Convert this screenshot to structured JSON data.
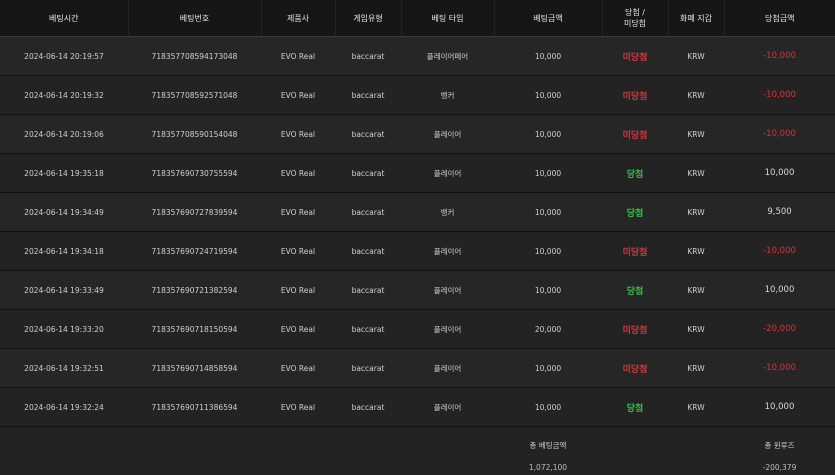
{
  "headers": {
    "bet_time": "베팅시간",
    "bet_id": "베팅번호",
    "provider": "제품사",
    "game_type": "게임유형",
    "bet_type": "베팅 타입",
    "bet_amount": "베팅금액",
    "result": "당첨 / 미당첨",
    "currency": "화폐 지갑",
    "payout": "당첨금액"
  },
  "rows": [
    {
      "time": "2024-06-14 20:19:57",
      "id": "718357708594173048",
      "provider": "EVO Real",
      "game": "baccarat",
      "type": "플레이어페어",
      "amount": "10,000",
      "result": "미당첨",
      "result_status": "lose",
      "currency": "KRW",
      "payout": "-10,000"
    },
    {
      "time": "2024-06-14 20:19:32",
      "id": "718357708592571048",
      "provider": "EVO Real",
      "game": "baccarat",
      "type": "뱅커",
      "amount": "10,000",
      "result": "미당첨",
      "result_status": "lose",
      "currency": "KRW",
      "payout": "-10,000"
    },
    {
      "time": "2024-06-14 20:19:06",
      "id": "718357708590154048",
      "provider": "EVO Real",
      "game": "baccarat",
      "type": "플레이어",
      "amount": "10,000",
      "result": "미당첨",
      "result_status": "lose",
      "currency": "KRW",
      "payout": "-10,000"
    },
    {
      "time": "2024-06-14 19:35:18",
      "id": "718357690730755594",
      "provider": "EVO Real",
      "game": "baccarat",
      "type": "플레이어",
      "amount": "10,000",
      "result": "당첨",
      "result_status": "win",
      "currency": "KRW",
      "payout": "10,000"
    },
    {
      "time": "2024-06-14 19:34:49",
      "id": "718357690727839594",
      "provider": "EVO Real",
      "game": "baccarat",
      "type": "뱅커",
      "amount": "10,000",
      "result": "당첨",
      "result_status": "win",
      "currency": "KRW",
      "payout": "9,500"
    },
    {
      "time": "2024-06-14 19:34:18",
      "id": "718357690724719594",
      "provider": "EVO Real",
      "game": "baccarat",
      "type": "플레이어",
      "amount": "10,000",
      "result": "미당첨",
      "result_status": "lose",
      "currency": "KRW",
      "payout": "-10,000"
    },
    {
      "time": "2024-06-14 19:33:49",
      "id": "718357690721382594",
      "provider": "EVO Real",
      "game": "baccarat",
      "type": "플레이어",
      "amount": "10,000",
      "result": "당첨",
      "result_status": "win",
      "currency": "KRW",
      "payout": "10,000"
    },
    {
      "time": "2024-06-14 19:33:20",
      "id": "718357690718150594",
      "provider": "EVO Real",
      "game": "baccarat",
      "type": "플레이어",
      "amount": "20,000",
      "result": "미당첨",
      "result_status": "lose",
      "currency": "KRW",
      "payout": "-20,000"
    },
    {
      "time": "2024-06-14 19:32:51",
      "id": "718357690714858594",
      "provider": "EVO Real",
      "game": "baccarat",
      "type": "플레이어",
      "amount": "10,000",
      "result": "미당첨",
      "result_status": "lose",
      "currency": "KRW",
      "payout": "-10,000"
    },
    {
      "time": "2024-06-14 19:32:24",
      "id": "718357690711386594",
      "provider": "EVO Real",
      "game": "baccarat",
      "type": "플레이어",
      "amount": "10,000",
      "result": "당첨",
      "result_status": "win",
      "currency": "KRW",
      "payout": "10,000"
    }
  ],
  "totals": {
    "bet_label": "총 베팅금액",
    "bet_value": "1,072,100",
    "winloss_label": "총 윈루즈",
    "winloss_value": "-200,379"
  },
  "colors": {
    "lose": "#e0323a",
    "win": "#36c24a",
    "background": "#1a1a1a"
  }
}
